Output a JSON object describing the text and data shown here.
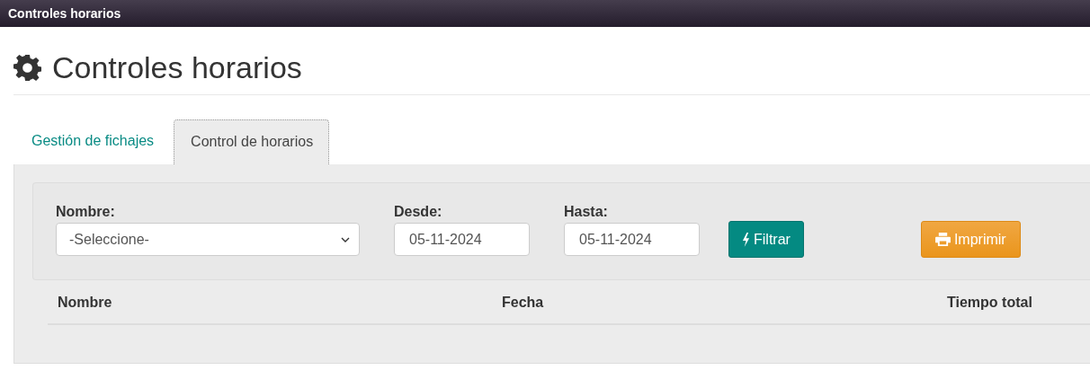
{
  "window": {
    "title": "Controles horarios"
  },
  "page_title": "Controles horarios",
  "tabs": [
    {
      "label": "Gestión de fichajes",
      "selected": false
    },
    {
      "label": "Control de horarios",
      "selected": true
    }
  ],
  "filters": [
    {
      "kind": "select",
      "label": "Nombre:",
      "value": "-Seleccione-"
    },
    {
      "kind": "date",
      "label": "Desde:",
      "value": "05-11-2024"
    },
    {
      "kind": "date",
      "label": "Hasta:",
      "value": "05-11-2024"
    }
  ],
  "buttons": [
    {
      "kind": "filter",
      "label": "Filtrar"
    },
    {
      "kind": "print",
      "label": "Imprimir"
    }
  ],
  "table": {
    "columns": [
      "Nombre",
      "Fecha",
      "Tiempo total"
    ]
  }
}
